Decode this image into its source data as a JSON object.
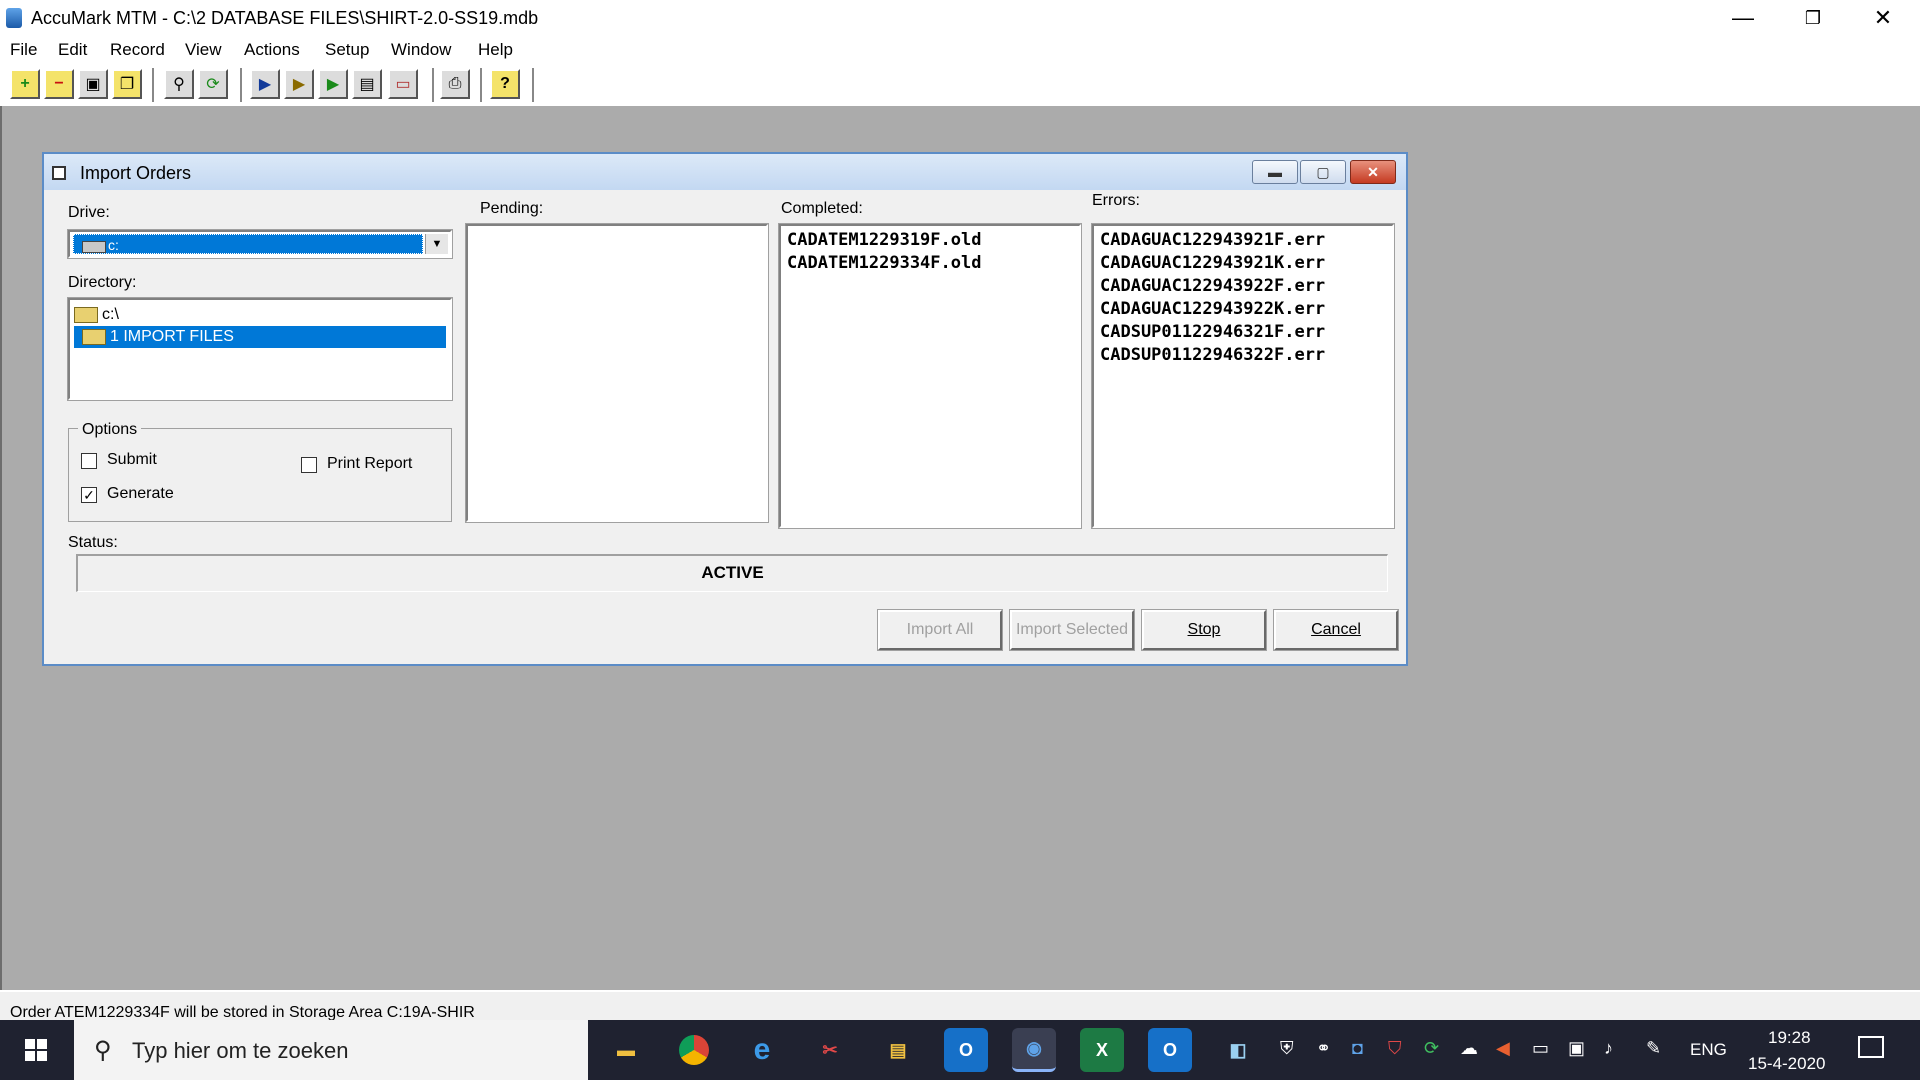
{
  "window": {
    "title": "AccuMark MTM - C:\\2 DATABASE FILES\\SHIRT-2.0-SS19.mdb",
    "controls": {
      "minimize": "—",
      "restore": "❐",
      "close": "✕"
    }
  },
  "menu": [
    "File",
    "Edit",
    "Record",
    "View",
    "Actions",
    "Setup",
    "Window",
    "Help"
  ],
  "toolbar_icons": [
    "add-record-icon",
    "delete-record-icon",
    "save-icon",
    "copy-icon",
    "find-icon",
    "refresh-icon",
    "play-icon",
    "step-icon",
    "run-icon",
    "preview-icon",
    "eraser-icon",
    "print-icon",
    "help-icon"
  ],
  "dialog": {
    "title": "Import Orders",
    "drive_label": "Drive:",
    "drive_value": "c:",
    "directory_label": "Directory:",
    "directories": [
      "c:\\",
      "1 IMPORT FILES"
    ],
    "options_label": "Options",
    "options": {
      "submit": {
        "label": "Submit",
        "checked": false
      },
      "generate": {
        "label": "Generate",
        "checked": true
      },
      "print_report": {
        "label": "Print Report",
        "checked": false
      }
    },
    "pending_label": "Pending:",
    "pending": [],
    "completed_label": "Completed:",
    "completed": [
      "CADATEM1229319F.old",
      "CADATEM1229334F.old"
    ],
    "errors_label": "Errors:",
    "errors": [
      "CADAGUAC122943921F.err",
      "CADAGUAC122943921K.err",
      "CADAGUAC122943922F.err",
      "CADAGUAC122943922K.err",
      "CADSUP01122946321F.err",
      "CADSUP01122946322F.err"
    ],
    "status_label": "Status:",
    "status_value": "ACTIVE",
    "buttons": {
      "import_all": "Import All",
      "import_selected": "Import Selected",
      "stop": "Stop",
      "cancel": "Cancel"
    }
  },
  "status_bar": "Order ATEM1229334F will be stored in Storage Area C:19A-SHIR",
  "taskbar": {
    "search_placeholder": "Typ hier om te zoeken",
    "language": "ENG",
    "time": "19:28",
    "date": "15-4-2020",
    "colors": {
      "taskbar": "#1f2230",
      "accent": "#0078d7"
    }
  }
}
